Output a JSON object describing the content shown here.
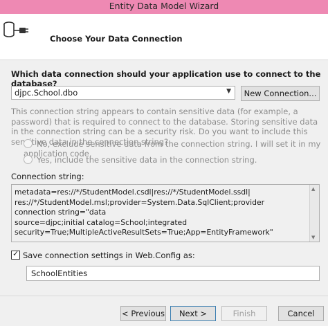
{
  "window": {
    "title": "Entity Data Model Wizard"
  },
  "header": {
    "title": "Choose Your Data Connection",
    "icon": "database-plug-icon"
  },
  "question": "Which data connection should your application use to connect to the database?",
  "connection_select": {
    "selected": "djpc.School.dbo"
  },
  "new_connection_button": "New Connection...",
  "sensitive_message": "This connection string appears to contain sensitive data (for example, a password) that is required to connect to the database. Storing sensitive data in the connection string can be a security risk. Do you want to include this sensitive data in the connection string?",
  "radio_options": [
    "No, exclude sensitive data from the connection string. I will set it in my application code.",
    "Yes, include the sensitive data in the connection string."
  ],
  "connection_string": {
    "label": "Connection string:",
    "value": "metadata=res://*/StudentModel.csdl|res://*/StudentModel.ssdl|\nres://*/StudentModel.msl;provider=System.Data.SqlClient;provider connection string=\"data\nsource=djpc;initial catalog=School;integrated\nsecurity=True;MultipleActiveResultSets=True;App=EntityFramework\""
  },
  "save_settings": {
    "label": "Save connection settings in Web.Config as:",
    "checked": true,
    "value": "SchoolEntities"
  },
  "buttons": {
    "previous": "< Previous",
    "next": "Next >",
    "finish": "Finish",
    "cancel": "Cancel"
  }
}
